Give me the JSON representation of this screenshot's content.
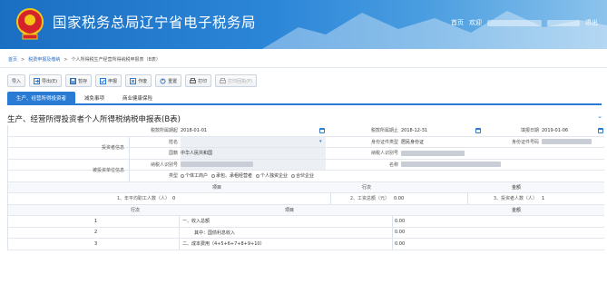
{
  "header": {
    "site_title": "国家税务总局辽宁省电子税务局",
    "home": "首页",
    "welcome": "欢迎",
    "exit": "退出"
  },
  "breadcrumb": [
    "首页",
    "税费申报及缴纳",
    "个人所得税生产经营所得纳税申报表（B表）"
  ],
  "toolbar": {
    "import": "导入",
    "export": "导出(E)",
    "save_draft": "暂存",
    "declare": "申报",
    "clear": "作废",
    "reset": "重置",
    "print": "打印",
    "print_receipt": "打印回执(P)"
  },
  "tabs": [
    "生产、经营所得投资者",
    "减免事项",
    "商业健康保险"
  ],
  "form": {
    "title": "生产、经营所得投资者个人所得税纳税申报表(B表)",
    "period_start_label": "税款所属期起",
    "period_start": "2018-01-01",
    "period_end_label": "税款所属期止",
    "period_end": "2018-12-31",
    "fill_date_label": "填报日期",
    "fill_date": "2019-01-06",
    "investor_info_label": "投资者信息",
    "name_label": "姓名",
    "id_type_label": "身份证件类型",
    "id_type": "居民身份证",
    "id_number_label": "身份证件号码",
    "nationality_label": "国籍",
    "nationality": "中华人民共和国",
    "taxpayer_id_label": "纳税人识别号",
    "unit_info_label": "被投资单位信息",
    "unit_taxpayer_id_label": "纳税人识别号",
    "unit_name_label": "名称",
    "type_label": "类型",
    "types": [
      "个体工商户",
      "承包、承租经营者",
      "个人独资企业",
      "合伙企业"
    ],
    "item_header": "项目",
    "row_header": "行次",
    "amount_header": "金额",
    "r1_label": "1、年平均职工人数（人）",
    "r1_value": "0",
    "r2_label": "2、工资总额（元）",
    "r2_value": "0.00",
    "r3_label": "3、投资者人数（人）",
    "r3_value": "1",
    "lines": [
      {
        "no": "1",
        "item": "一、收入总额",
        "amount": "0.00"
      },
      {
        "no": "2",
        "item": "其中：国债利息收入",
        "amount": "0.00"
      },
      {
        "no": "3",
        "item": "二、成本费用（4+5+6+7+8+9+10）",
        "amount": "0.00"
      }
    ]
  }
}
